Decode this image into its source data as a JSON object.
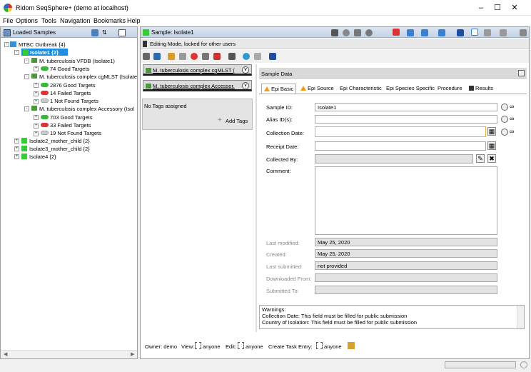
{
  "window": {
    "title": "Ridom SeqSphere+ (demo at localhost)"
  },
  "menu": [
    "File",
    "Options",
    "Tools",
    "Navigation",
    "Bookmarks",
    "Help"
  ],
  "left": {
    "title": "Loaded Samples",
    "tree": {
      "root": "MTBC Outbreak {4}",
      "isolate1": "Isolate1 {2}",
      "vfdb": "M. tuberculosis VFDB (Isolate1)",
      "vfdb_good": "74 Good Targets",
      "cgmlst": "M. tuberculosis complex cgMLST (Isolate",
      "cg_good": "2876 Good Targets",
      "cg_failed": "14 Failed Targets",
      "cg_notfound": "1 Not Found Targets",
      "accessory": "M. tuberculosis complex Accessory (Isol",
      "acc_good": "703 Good Targets",
      "acc_failed": "33 Failed Targets",
      "acc_notfound": "19 Not Found Targets",
      "isolate2": "Isolate2_mother_child {2}",
      "isolate3": "Isolate3_mother_child {2}",
      "isolate4": "Isolate4 {2}"
    }
  },
  "right": {
    "title": "Sample: Isolate1",
    "edit_mode": "Editing Mode, locked for other users",
    "modules": [
      "M. tuberculosis complex cgMLST (...",
      "M. tuberculosis complex Accessor..."
    ],
    "no_tags": "No Tags assigned",
    "add_tags": "Add Tags",
    "sample_data": "Sample Data",
    "tabs": [
      "Epi Basic",
      "Epi Source",
      "Epi Characteristic",
      "Epi Species Specific",
      "Procedure",
      "Results"
    ],
    "fields": {
      "sample_id_label": "Sample ID:",
      "sample_id": "Isolate1",
      "alias_label": "Alias ID(s):",
      "collection_date_label": "Collection Date:",
      "receipt_date_label": "Receipt Date:",
      "collected_by_label": "Collected By:",
      "comment_label": "Comment:",
      "last_modified_label": "Last modified:",
      "last_modified": "May 25, 2020",
      "created_label": "Created:",
      "created": "May 25, 2020",
      "last_submitted_label": "Last submitted:",
      "last_submitted": "not provided",
      "downloaded_label": "Downloaded From:",
      "submitted_label": "Submitted To:"
    },
    "warnings": {
      "title": "Warnings:",
      "line1": "Collection Date: This field must be filled for public submission",
      "line2": "Country of Isolation: This field must be filled for public submission"
    },
    "footer": {
      "owner": "Owner: demo",
      "view": "View:",
      "view_val": "anyone",
      "edit": "Edit:",
      "edit_val": "anyone",
      "create": "Create Task Entry:",
      "create_val": "anyone"
    }
  },
  "colors": {
    "selection": "#1e8fe0",
    "accent_orange": "#f39c12",
    "header_blue": "#c5d3e6"
  }
}
